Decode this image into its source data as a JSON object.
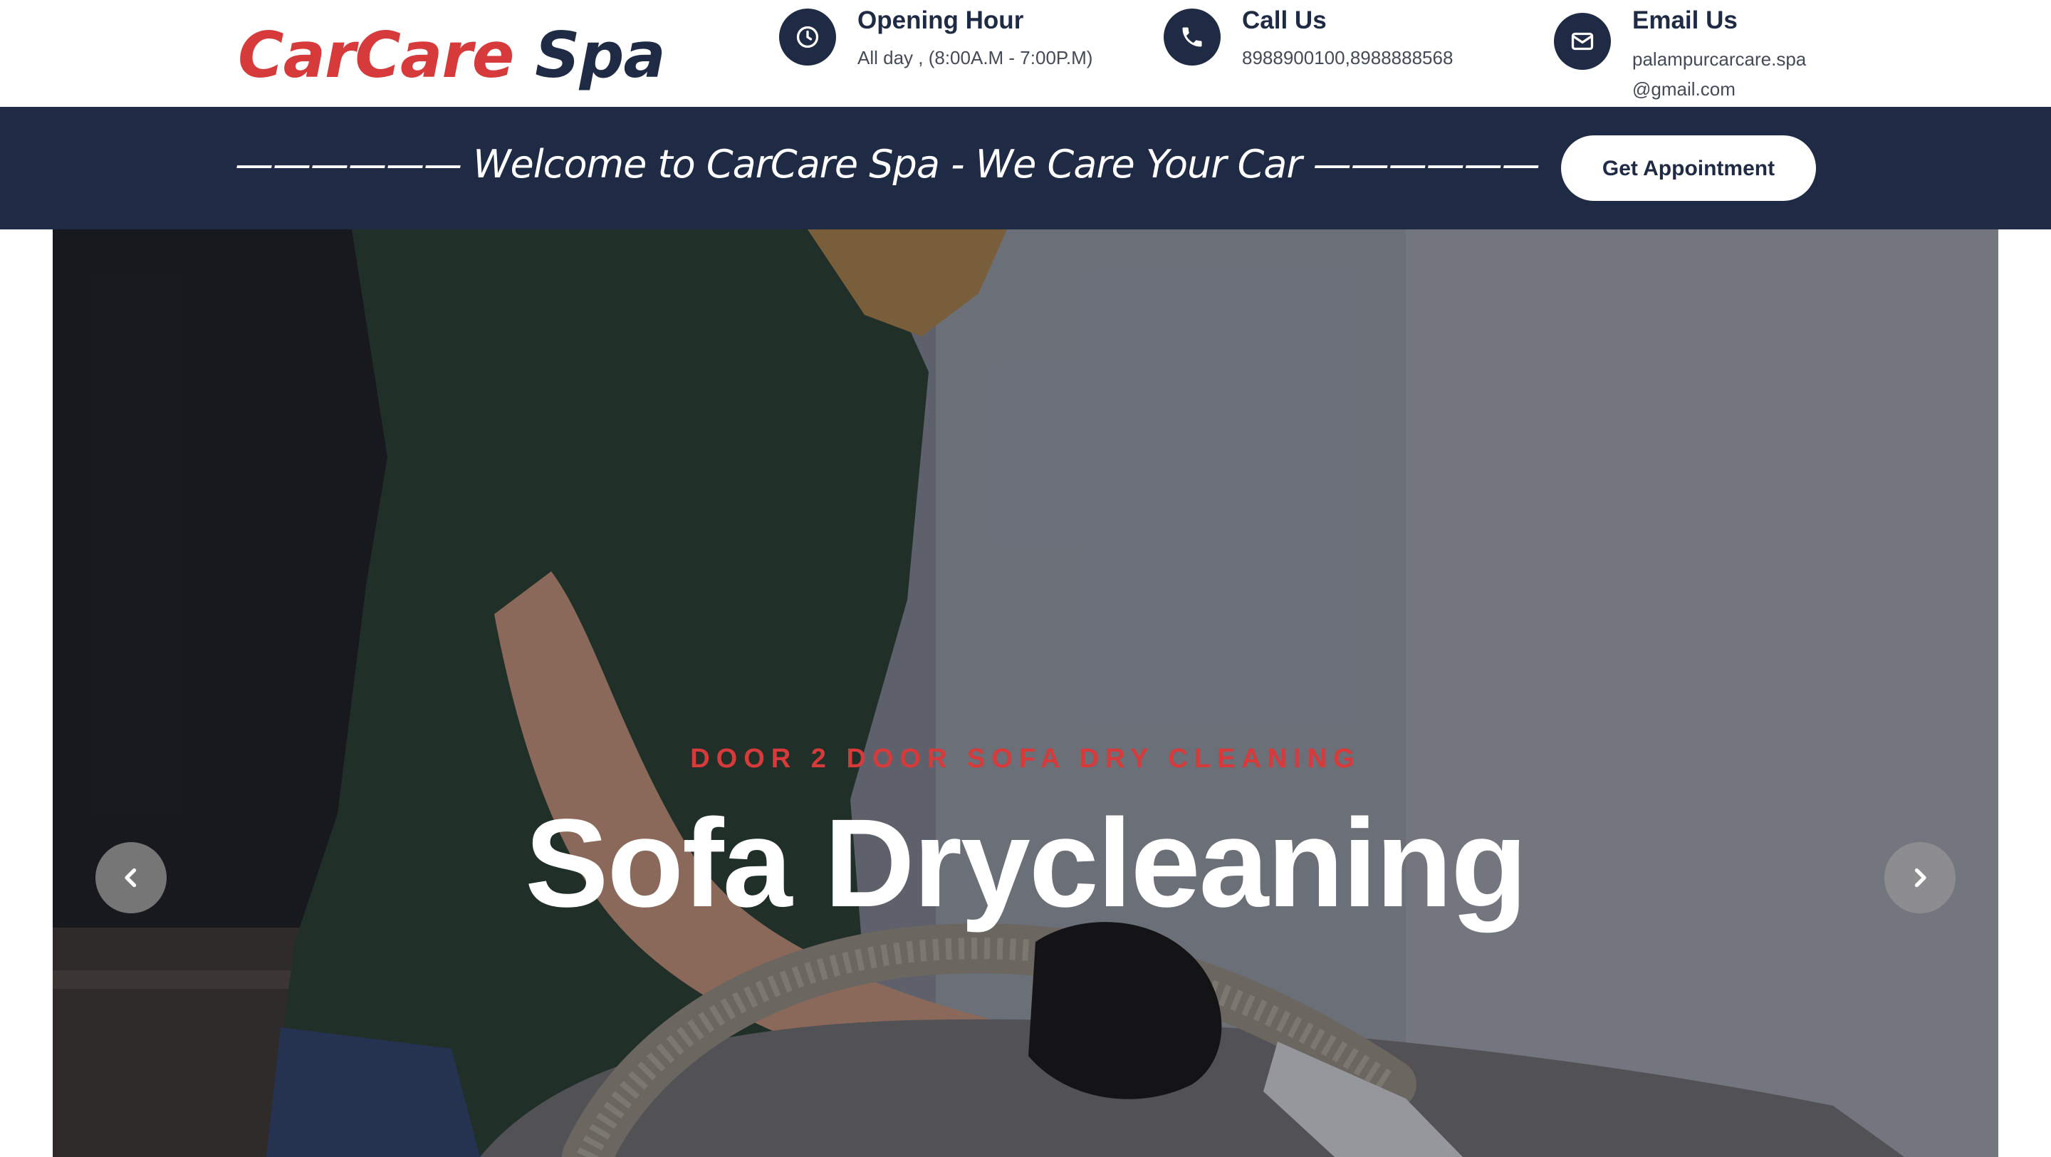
{
  "brand": {
    "part1": "CarCare",
    "part2": "Spa"
  },
  "header": {
    "opening": {
      "title": "Opening Hour",
      "text": "All day , (8:00A.M - 7:00P.M)",
      "icon": "clock-icon"
    },
    "call": {
      "title": "Call Us",
      "text": "8988900100,8988888568",
      "icon": "phone-icon"
    },
    "email": {
      "title": "Email Us",
      "line1": "palampurcarcare.spa",
      "line2": "@gmail.com",
      "icon": "envelope-icon"
    }
  },
  "band": {
    "welcome": "—————— Welcome to CarCare Spa - We Care Your Car ——————",
    "button": "Get Appointment"
  },
  "hero": {
    "subtitle": "DOOR 2 DOOR SOFA DRY CLEANING",
    "title": "Sofa Drycleaning",
    "prev_icon": "chevron-left-icon",
    "next_icon": "chevron-right-icon"
  },
  "colors": {
    "brand_red": "#d63a3a",
    "navy": "#1f2a44"
  }
}
